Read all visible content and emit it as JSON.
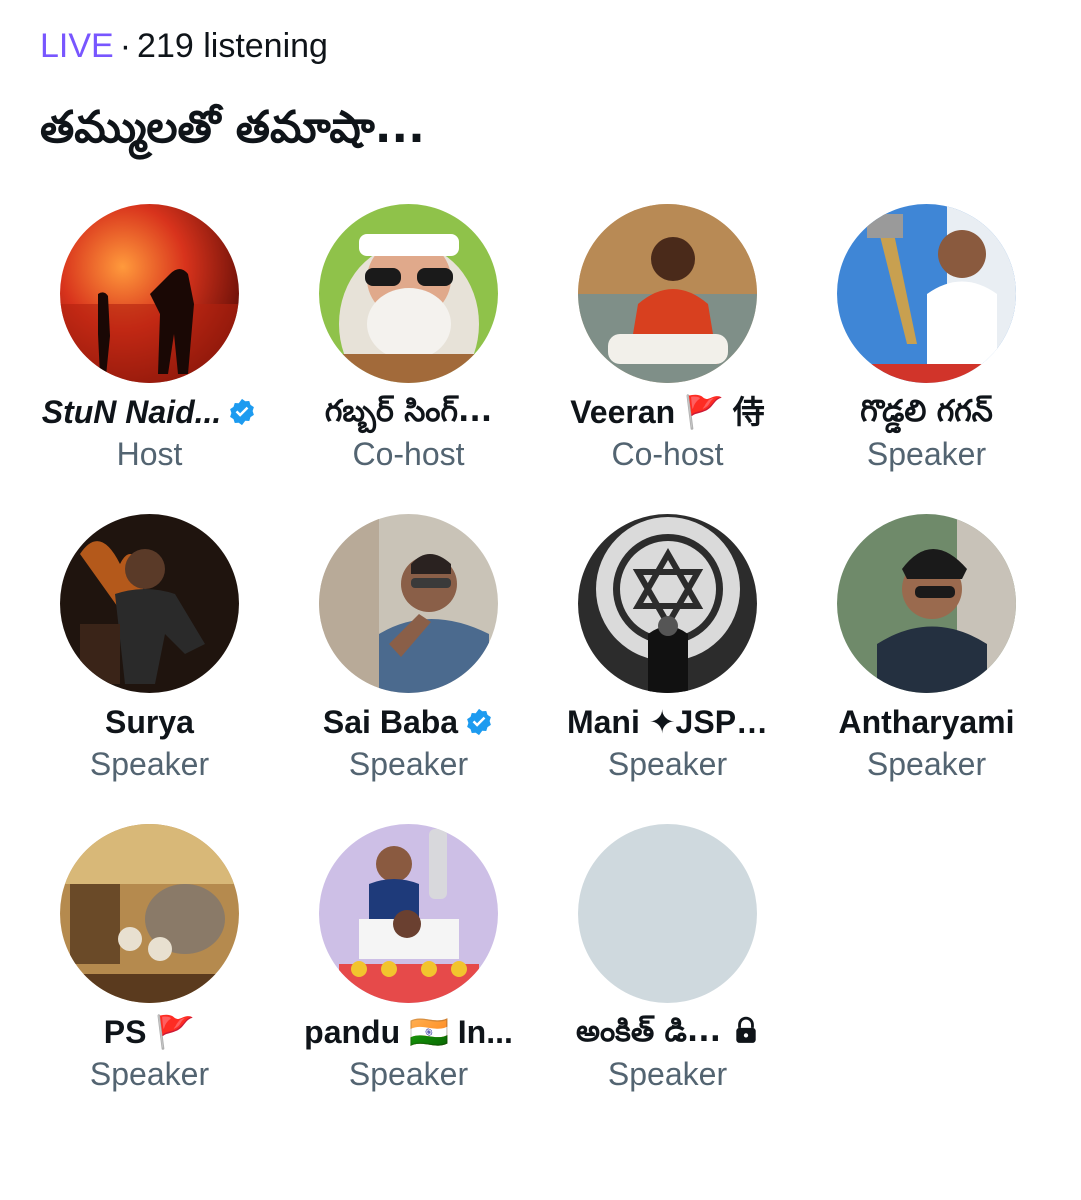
{
  "status": {
    "live_label": "LIVE",
    "separator": "·",
    "listening": "219 listening"
  },
  "space": {
    "title": "తమ్ములతో తమాషా..."
  },
  "participants": [
    {
      "name": "StuN Naid...",
      "role": "Host",
      "verified": true
    },
    {
      "name": "గబ్బర్ సింగ్...",
      "role": "Co-host"
    },
    {
      "name": "Veeran",
      "flag": "🚩",
      "extra": "侍",
      "role": "Co-host"
    },
    {
      "name": "గొడ్డలి గగన్",
      "role": "Speaker"
    },
    {
      "name": "Surya",
      "role": "Speaker"
    },
    {
      "name": "Sai Baba",
      "role": "Speaker",
      "verified": true
    },
    {
      "name": "Mani ✦JSP…",
      "role": "Speaker"
    },
    {
      "name": "Antharyami",
      "role": "Speaker"
    },
    {
      "name": "PS",
      "flag": "🚩",
      "role": "Speaker"
    },
    {
      "name": "pandu",
      "flag": "🇮🇳",
      "extra": "In...",
      "role": "Speaker"
    },
    {
      "name": "అంకిత్ డి...",
      "role": "Speaker",
      "locked": true
    }
  ],
  "colors": {
    "live": "#7856ff",
    "verified": "#1d9bf0",
    "role_text": "#536471",
    "placeholder_avatar": "#cfd9de"
  },
  "icons": {
    "verified": "verified-badge-icon",
    "lock": "lock-icon"
  }
}
